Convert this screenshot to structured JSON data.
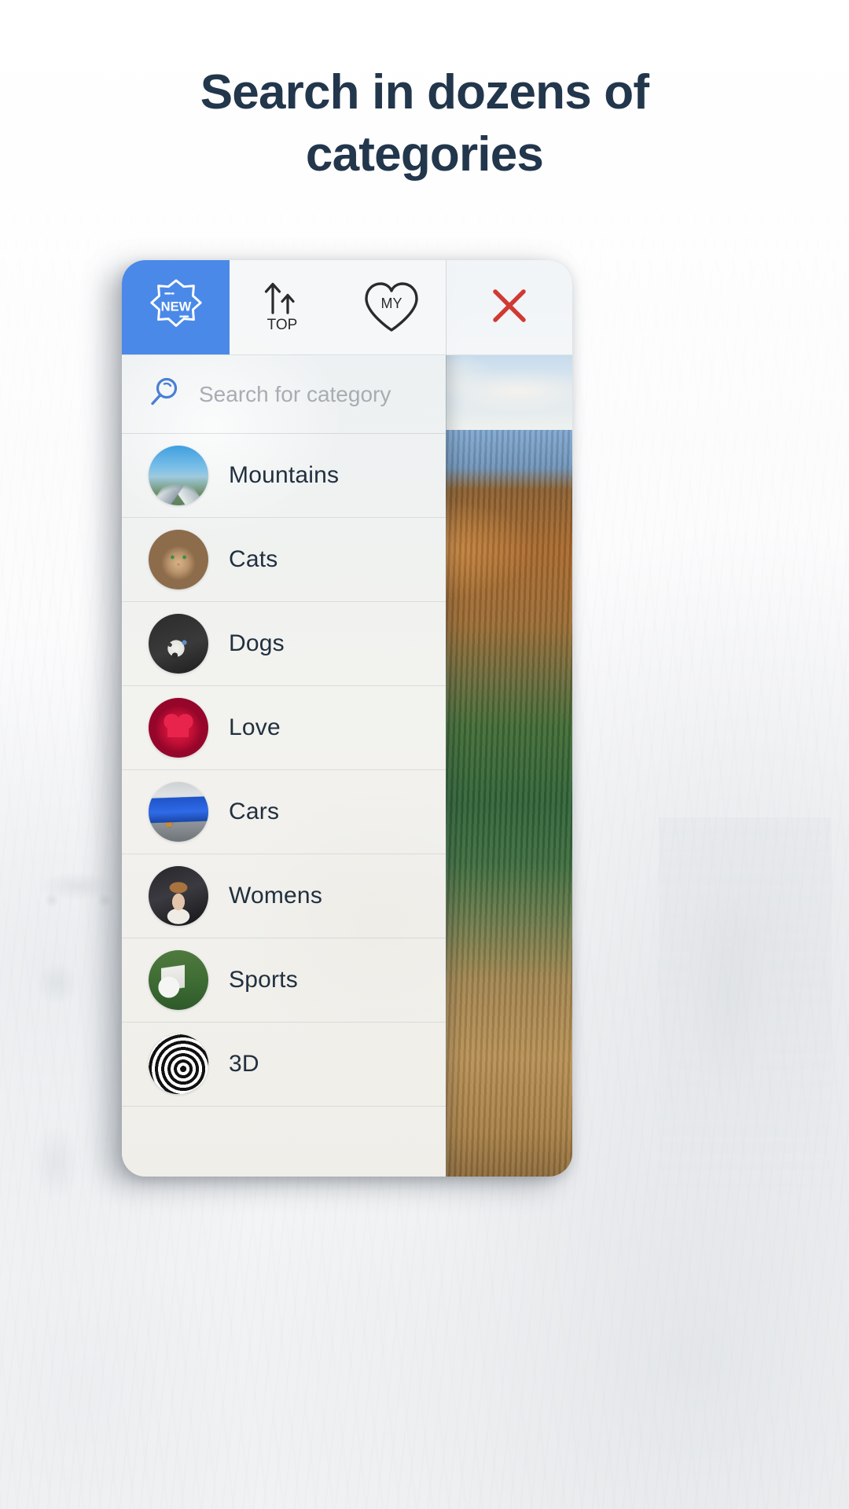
{
  "headline": "Search in dozens of categories",
  "colors": {
    "headline": "#22364c",
    "accent_blue": "#4a89e8",
    "close_red": "#d03a33",
    "label_dark": "#21303f",
    "placeholder_gray": "#a8adb2"
  },
  "app": {
    "tabs": [
      {
        "id": "new",
        "label": "NEW",
        "icon": "new-badge-icon",
        "active": true
      },
      {
        "id": "top",
        "label": "TOP",
        "icon": "top-arrows-icon",
        "active": false
      },
      {
        "id": "my",
        "label": "MY",
        "icon": "my-heart-icon",
        "active": false
      }
    ],
    "close_button": {
      "label": "",
      "icon": "close-x-icon"
    },
    "search": {
      "icon": "search-icon",
      "value": "",
      "placeholder": "Search for category"
    },
    "categories": [
      {
        "label": "Mountains",
        "thumb": "mountains-thumb"
      },
      {
        "label": "Cats",
        "thumb": "cats-thumb"
      },
      {
        "label": "Dogs",
        "thumb": "dogs-thumb"
      },
      {
        "label": "Love",
        "thumb": "love-thumb"
      },
      {
        "label": "Cars",
        "thumb": "cars-thumb"
      },
      {
        "label": "Womens",
        "thumb": "womens-thumb"
      },
      {
        "label": "Sports",
        "thumb": "sports-thumb"
      },
      {
        "label": "3D",
        "thumb": "3d-thumb"
      }
    ]
  }
}
